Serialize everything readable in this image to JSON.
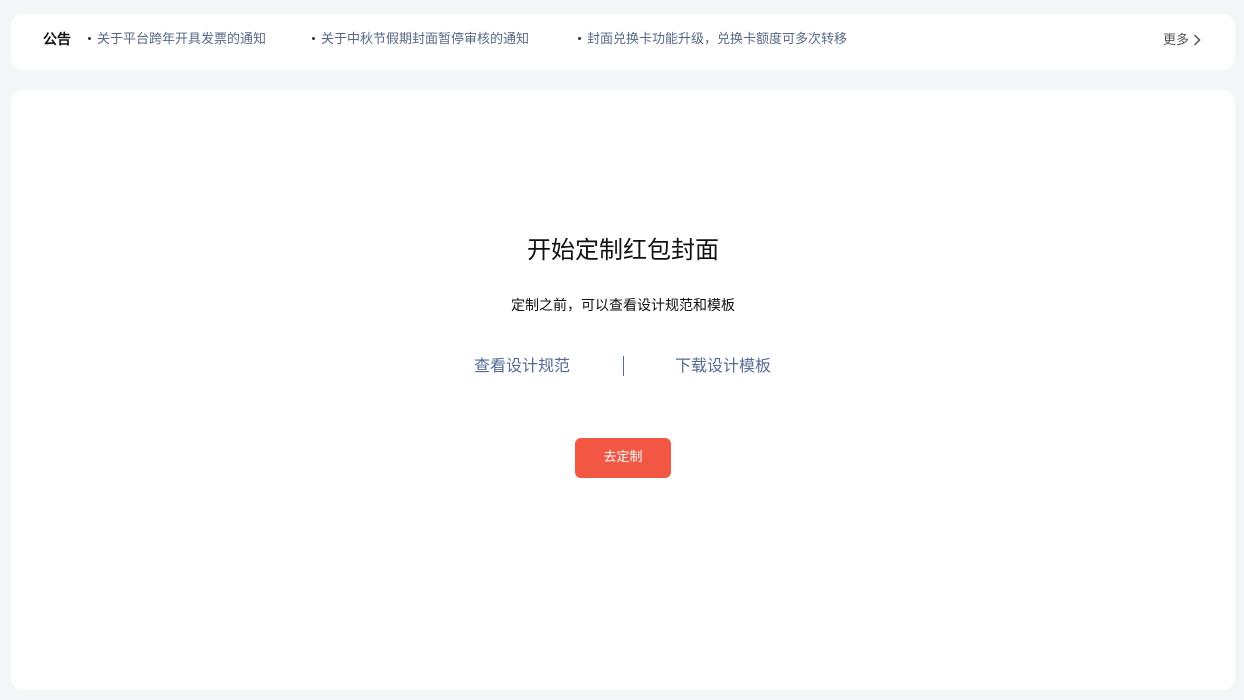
{
  "notice": {
    "title": "公告",
    "items": [
      {
        "text": "关于平台跨年开具发票的通知"
      },
      {
        "text": "关于中秋节假期封面暂停审核的通知"
      },
      {
        "text": "封面兑换卡功能升级，兑换卡额度可多次转移"
      }
    ],
    "more_label": "更多",
    "more_icon": "chevron-right-icon"
  },
  "main": {
    "title": "开始定制红包封面",
    "subtitle": "定制之前，可以查看设计规范和模板",
    "spec_link": "查看设计规范",
    "template_link": "下载设计模板",
    "go_button": "去定制"
  },
  "colors": {
    "accent": "#f25744",
    "link": "#576b95",
    "background": "#f5f6f8"
  }
}
